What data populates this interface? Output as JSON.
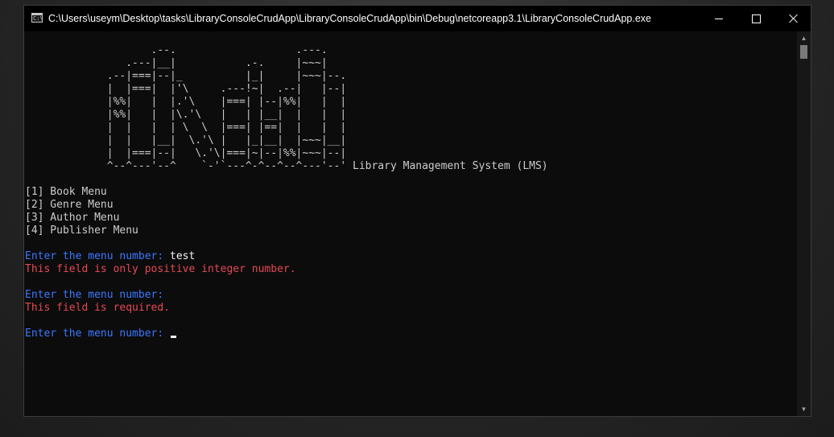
{
  "window": {
    "title": "C:\\Users\\useym\\Desktop\\tasks\\LibraryConsoleCrudApp\\LibraryConsoleCrudApp\\bin\\Debug\\netcoreapp3.1\\LibraryConsoleCrudApp.exe",
    "icon": "console-app-icon",
    "icon_label": "C:\\",
    "controls": [
      "minimize-icon",
      "maximize-icon",
      "close-icon"
    ]
  },
  "banner": {
    "art_lines": [
      "                    .--.                   .---.",
      "                .---|__|           .-.     |~~~|",
      "             .--|===|--|_          |_|     |~~~|--.",
      "             |  |===|  |'\\     .---!~|  .--|   |--|",
      "             |%%|   |  |.'\\    |===| |--|%%|   |  |",
      "             |%%|   |  |\\.'\\   |   | |__|  |   |  |",
      "             |  |   |  | \\  \\  |===| |==|  |   |  |",
      "             |  |   |__|  \\.'\\ |   |_|__|  |~~~|__|",
      "             |  |===|--|   \\.'\\|===|~|--|%%|~~~|--|",
      "             ^--^---'--^    `-'`---^-^--^--^---'--'"
    ],
    "caption": " Library Management System (LMS)"
  },
  "menu": {
    "items": [
      "[1] Book Menu",
      "[2] Genre Menu",
      "[3] Author Menu",
      "[4] Publisher Menu"
    ]
  },
  "session": {
    "prompt_1": "Enter the menu number: ",
    "input_1": "test",
    "error_1": "This field is only positive integer number.",
    "prompt_2": "Enter the menu number: ",
    "error_2": "This field is required.",
    "prompt_3": "Enter the menu number: "
  },
  "colors": {
    "prompt": "#3b78ff",
    "error": "#e74856",
    "text": "#cccccc",
    "background": "#0c0c0c"
  }
}
